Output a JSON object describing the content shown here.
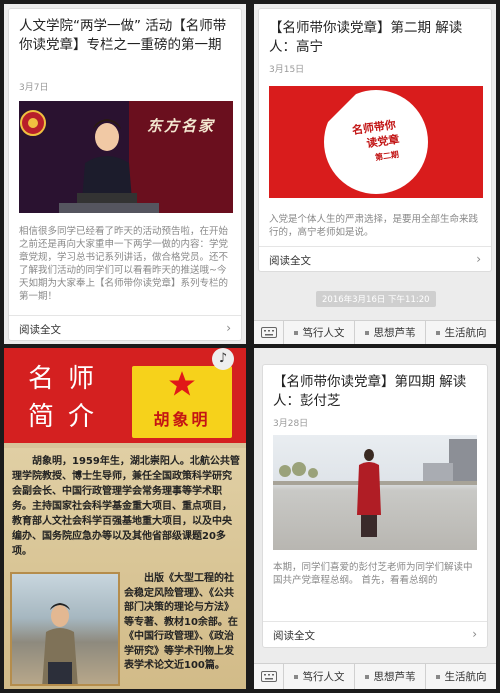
{
  "panel1": {
    "title": "人文学院“两学一做” 活动【名师带你读党章】专栏之一重磅的第一期",
    "date": "3月7日",
    "image_caption": "东方名家",
    "summary": "相信很多同学已经看了昨天的活动预告啦，在开始之前还是再向大家重申一下两学一做的内容：学党章党规，学习总书记系列讲话，做合格党员。还不了解我们活动的同学们可以看看昨天的推送哦~今天如期为大家奉上【名师带你读党章】系列专栏的第一期！",
    "read_more": "阅读全文"
  },
  "panel2": {
    "title": "【名师带你读党章】第二期 解读人：高宁",
    "date": "3月15日",
    "cover_text_line1": "名师带你",
    "cover_text_line2": "读党章",
    "cover_text_line3": "第二期",
    "summary": "入党是个体人生的严肃选择，是要用全部生命来践行的，高宁老师如是说。",
    "read_more": "阅读全文",
    "timestamp": "2016年3月16日 下午11:20"
  },
  "panel3": {
    "heading_line1": "名师",
    "heading_line2": "简介",
    "name": "胡象明",
    "bio_intro": "胡象明，1959年生，湖北崇阳人。北航公共管理学院教授、博士生导师，兼任全国政策科学研究会副会长、中国行政管理学会常务理事等学术职务。主持国家社会科学基金重大项目、重点项目，教育部人文社会科学百强基地重大项目，以及中央编办、国务院应急办等以及其他省部级课题20多项。",
    "bio_rest": "出版《大型工程的社会稳定风险管理》、《公共部门决策的理论与方法》等专著、教材10余部。在《中国行政管理》、《政治学研究》等学术刊物上发表学术论文近100篇。"
  },
  "panel4": {
    "title": "【名师带你读党章】第四期 解读人：彭付芝",
    "date": "3月28日",
    "summary": "本期，同学们喜爱的彭付芝老师为同学们解读中国共产党章程总纲。 首先，看看总纲的",
    "read_more": "阅读全文"
  },
  "menu": {
    "item1": "笃行人文",
    "item2": "思想芦苇",
    "item3": "生活航向"
  },
  "colors": {
    "party_red": "#d42020",
    "gold": "#f6d21b"
  },
  "icons": {
    "keyboard": "keyboard-icon",
    "music": "music-note-icon",
    "arrow": "chevron-right-icon"
  }
}
